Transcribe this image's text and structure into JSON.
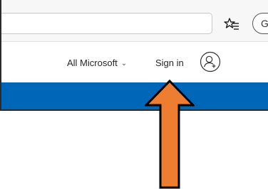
{
  "browser": {
    "favorites_icon": "favorites-star-icon",
    "profile_initial": "G"
  },
  "header": {
    "all_microsoft_label": "All Microsoft",
    "all_microsoft_chevron": "⌄",
    "sign_in_label": "Sign in",
    "account_icon": "add-account-icon"
  },
  "colors": {
    "blue_bar": "#0067b8",
    "arrow_fill": "#ed7d31",
    "arrow_outline": "#000000"
  }
}
